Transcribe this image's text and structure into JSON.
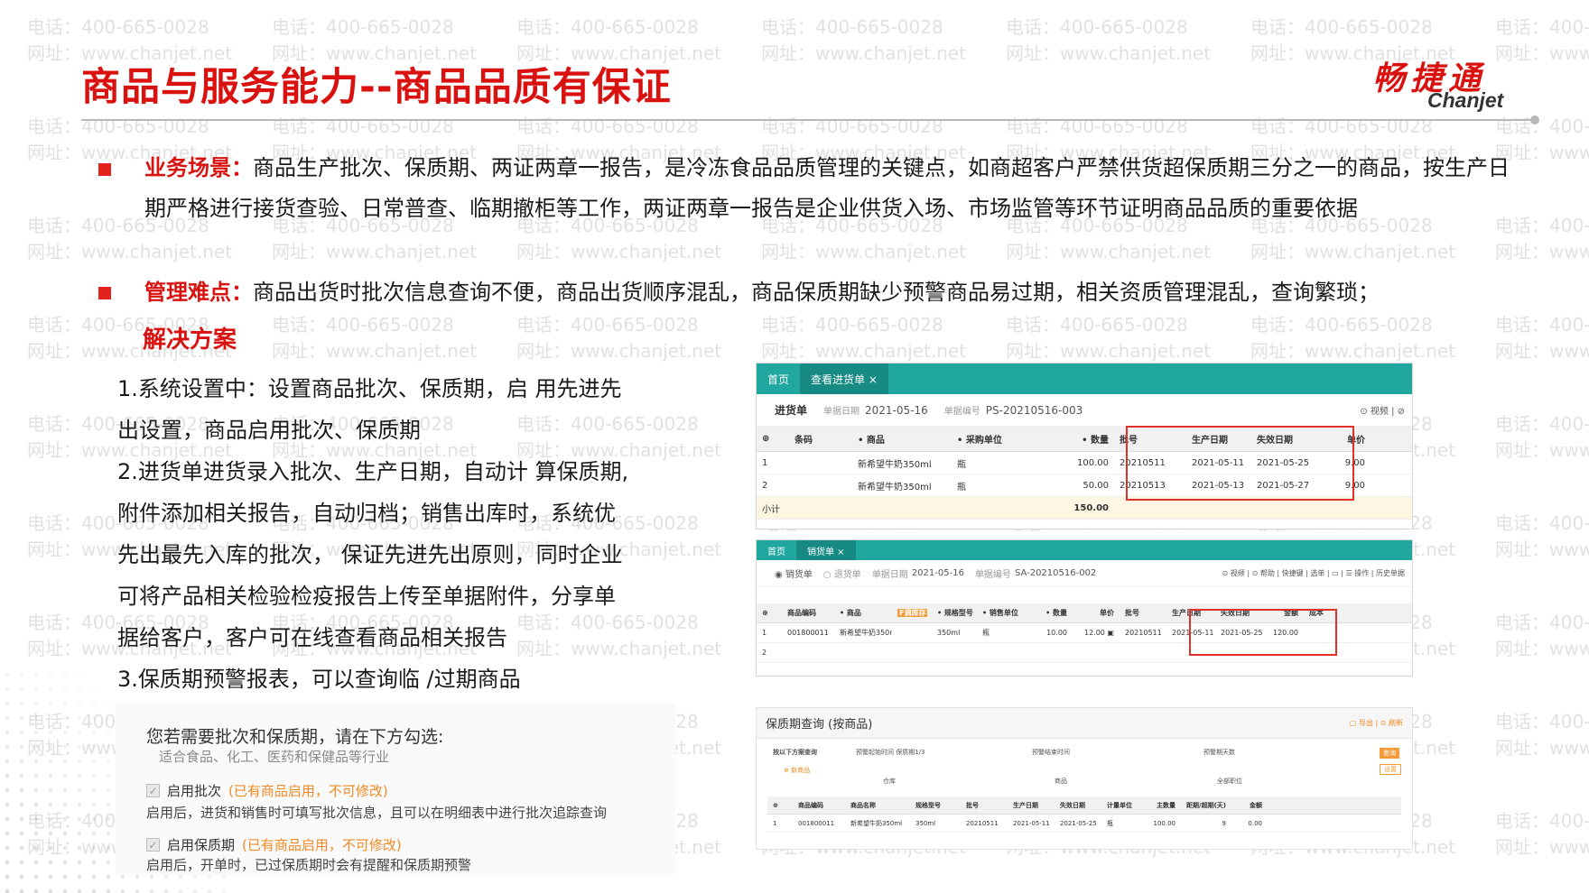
{
  "watermark": {
    "phone": "电话：400-665-0028",
    "site": "网址：www.chanjet.net"
  },
  "title": "商品与服务能力--商品品质有保证",
  "logo": {
    "cn": "畅捷通",
    "en": "Chanjet"
  },
  "scenario": {
    "label": "业务场景：",
    "text": "商品生产批次、保质期、两证两章一报告，是冷冻食品品质管理的关键点，如商超客户严禁供货超保质期三分之一的商品，按生产日期严格进行接货查验、日常普查、临期撤柜等工作，两证两章一报告是企业供货入场、市场监管等环节证明商品品质的重要依据"
  },
  "difficulty": {
    "label": "管理难点：",
    "text": "商品出货时批次信息查询不便，商品出货顺序混乱，商品保质期缺少预警商品易过期，相关资质管理混乱，查询繁琐；"
  },
  "solution": {
    "heading": "解决方案",
    "lines": [
      "1.系统设置中：设置商品批次、保质期，启 用先进先",
      "出设置，商品启用批次、保质期",
      "2.进货单进货录入批次、生产日期，自动计 算保质期,",
      "附件添加相关报告，自动归档；销售出库时，系统优",
      "先出最先入库的批次， 保证先进先出原则，同时企业",
      "可将产品相关检验检疫报告上传至单据附件，分享单",
      "据给客户，客户可在线查看商品相关报告",
      "3.保质期预警报表，可以查询临 /过期商品"
    ]
  },
  "settings": {
    "question": "您若需要批次和保质期，请在下方勾选:",
    "subtitle": "适合食品、化工、医药和保健品等行业",
    "batch": {
      "label": "启用批次",
      "hint": "(已有商品启用，不可修改)",
      "desc": "启用后，进货和销售时可填写批次信息，且可以在明细表中进行批次追踪查询"
    },
    "expiry": {
      "label": "启用保质期",
      "hint": "(已有商品启用，不可修改)",
      "desc": "启用后，开单时，已过保质期时会有提醒和保质期预警"
    },
    "check_glyph": "✓"
  },
  "purchase": {
    "tabs": [
      "首页",
      "查看进货单 ×"
    ],
    "doc_type": "进货单",
    "date_label": "单据日期",
    "date": "2021-05-16",
    "no_label": "单据编号",
    "no": "PS-20210516-003",
    "tools": "⊙ 视频 | ⊘",
    "headers": [
      "⊕",
      "条码",
      "• 商品",
      "• 采购单位",
      "• 数量",
      "批号",
      "生产日期",
      "失效日期",
      "单价"
    ],
    "rows": [
      [
        "1",
        "",
        "新希望牛奶350ml",
        "瓶",
        "100.00",
        "20210511",
        "2021-05-11",
        "2021-05-25",
        "9.00"
      ],
      [
        "2",
        "",
        "新希望牛奶350ml",
        "瓶",
        "50.00",
        "20210513",
        "2021-05-13",
        "2021-05-27",
        "9.00"
      ]
    ],
    "subtotal_label": "小计",
    "subtotal_qty": "150.00"
  },
  "sales": {
    "tabs": [
      "首页",
      "销货单 ×"
    ],
    "doc_type": "◉ 销货单",
    "doc_type2": "○ 退货单",
    "date_label": "单据日期",
    "date": "2021-05-16",
    "no_label": "单据编号",
    "no": "SA-20210516-002",
    "tools": "⊙ 视频 | ⊙ 帮助 | 快捷键 | 选单 | ▭ | ☰ 操作 | 历史单据",
    "headers": [
      "⊕",
      "商品编码",
      "• 商品",
      "",
      "• 规格型号",
      "• 销售单位",
      "• 数量",
      "单价",
      "批号",
      "生产日期",
      "失效日期",
      "金额",
      "成本"
    ],
    "row_tag": "F调库存",
    "rows": [
      [
        "1",
        "001800011",
        "新希望牛奶350ml",
        "",
        "350ml",
        "瓶",
        "10.00",
        "12.00 ▣",
        "20210511",
        "2021-05-11",
        "2021-05-25",
        "120.00",
        ""
      ],
      [
        "2",
        "",
        "",
        "",
        "",
        "",
        "",
        "",
        "",
        "",
        "",
        "",
        ""
      ]
    ]
  },
  "expiry_report": {
    "title": "保质期查询 (按商品)",
    "tools": "▢ 导出 | ⊙ 刷新",
    "filter_label": "按以下方案查询",
    "filters": [
      "预警起始时间 保质期1/3",
      "预警结束时间",
      "预警期天数",
      "仓库",
      "商品",
      "全部职位"
    ],
    "new_tag": "⊕ 新商品",
    "btn_query": "查询",
    "btn_set": "设置",
    "headers": [
      "⊕",
      "商品编码",
      "商品名称",
      "规格型号",
      "批号",
      "生产日期",
      "失效日期",
      "计量单位",
      "主数量",
      "距期/超期(天)",
      "金额"
    ],
    "rows": [
      [
        "1",
        "001800011",
        "新希望牛奶350ml",
        "350ml",
        "20210511",
        "2021-05-11",
        "2021-05-25",
        "瓶",
        "100.00",
        "9",
        "0.00"
      ]
    ]
  }
}
